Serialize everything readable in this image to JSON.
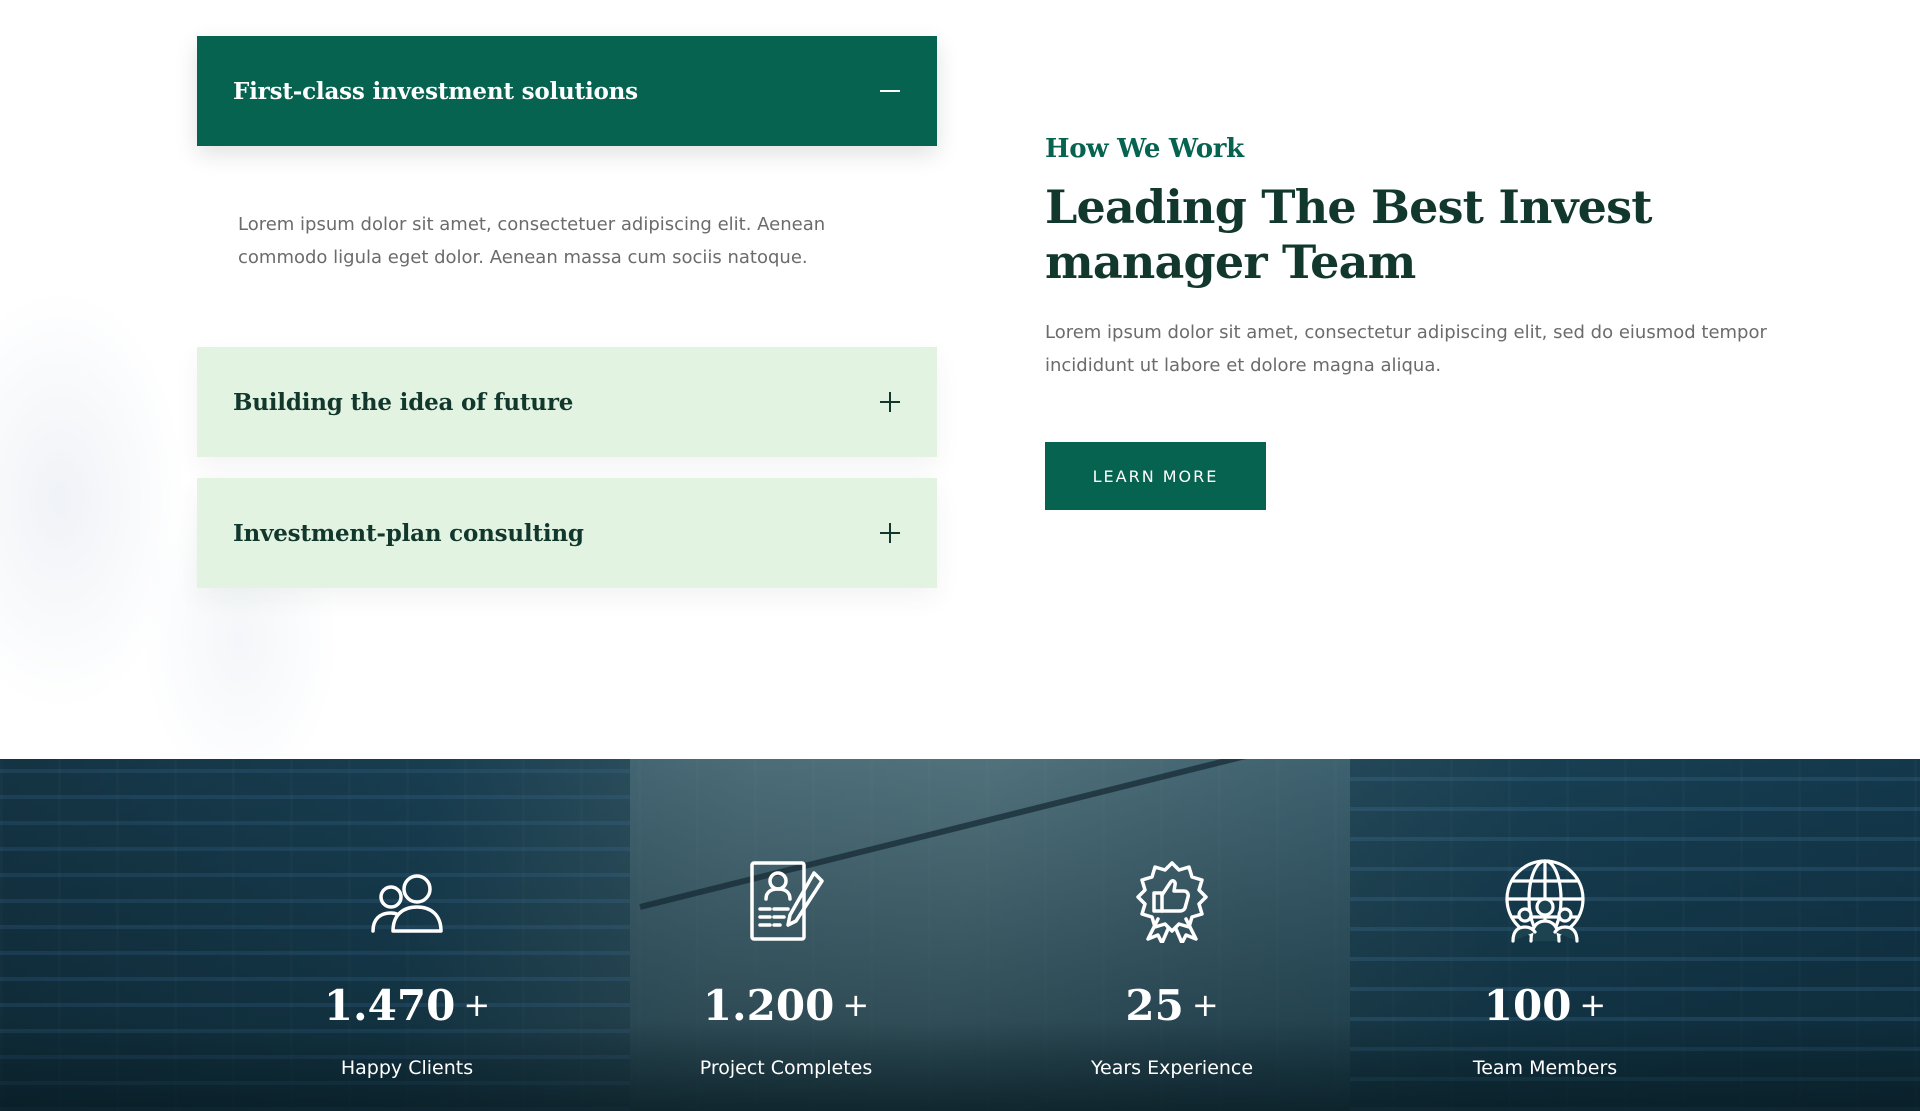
{
  "accordion": {
    "items": [
      {
        "title": "First-class investment solutions",
        "open": true,
        "body": "Lorem ipsum dolor sit amet, consectetuer adipiscing elit. Aenean commodo ligula eget dolor. Aenean massa cum sociis natoque."
      },
      {
        "title": "Building the idea of future",
        "open": false
      },
      {
        "title": "Investment-plan consulting",
        "open": false
      }
    ]
  },
  "intro": {
    "eyebrow": "How We Work",
    "headline_line1": "Leading The Best Invest",
    "headline_line2": "manager Team",
    "lead": "Lorem ipsum dolor sit amet, consectetur adipiscing elit, sed do eiusmod tempor incididunt ut labore et dolore magna aliqua.",
    "button_label": "LEARN MORE"
  },
  "stats": {
    "plus": "+",
    "items": [
      {
        "value": "1.470",
        "label": "Happy Clients",
        "icon": "users-icon"
      },
      {
        "value": "1.200",
        "label": "Project Completes",
        "icon": "document-pen-icon"
      },
      {
        "value": "25",
        "label": "Years Experience",
        "icon": "thumbs-up-badge-icon"
      },
      {
        "value": "100",
        "label": "Team Members",
        "icon": "globe-team-icon"
      }
    ]
  },
  "colors": {
    "primary": "#06634f",
    "dark_heading": "#12372d",
    "light_green": "#e3f3e2",
    "body_text": "#6b6b6b"
  }
}
